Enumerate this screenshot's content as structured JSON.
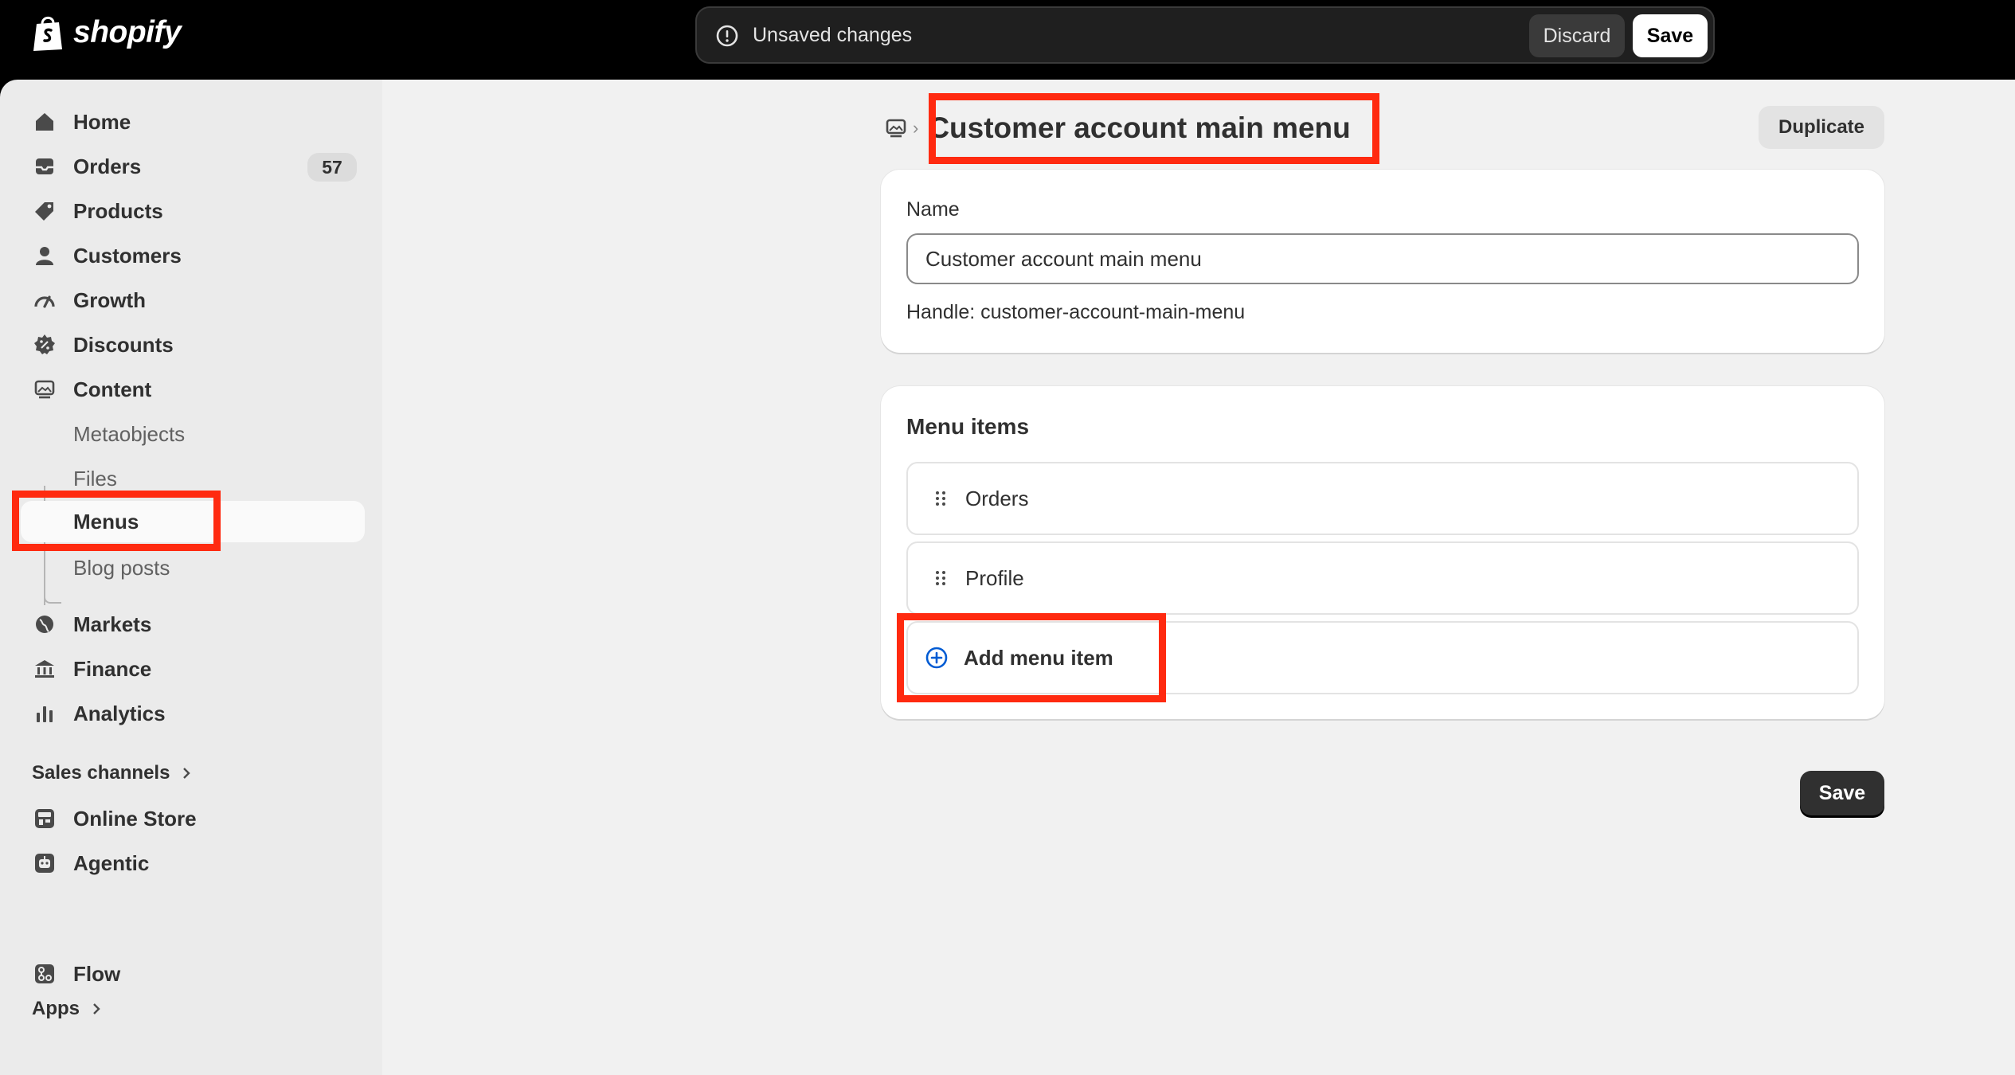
{
  "app": {
    "brand": "shopify"
  },
  "save_bar": {
    "message": "Unsaved changes",
    "discard_label": "Discard",
    "save_label": "Save"
  },
  "sidebar": {
    "items": [
      {
        "label": "Home",
        "icon": "home-icon"
      },
      {
        "label": "Orders",
        "icon": "inbox-icon",
        "badge": "57"
      },
      {
        "label": "Products",
        "icon": "tag-icon"
      },
      {
        "label": "Customers",
        "icon": "person-icon"
      },
      {
        "label": "Growth",
        "icon": "gauge-icon"
      },
      {
        "label": "Discounts",
        "icon": "discount-icon"
      },
      {
        "label": "Content",
        "icon": "image-icon"
      }
    ],
    "content_sub": [
      {
        "label": "Metaobjects"
      },
      {
        "label": "Files"
      },
      {
        "label": "Menus",
        "active": true
      },
      {
        "label": "Blog posts"
      }
    ],
    "items2": [
      {
        "label": "Markets",
        "icon": "globe-icon"
      },
      {
        "label": "Finance",
        "icon": "bank-icon"
      },
      {
        "label": "Analytics",
        "icon": "bar-chart-icon"
      }
    ],
    "sales_channels_heading": "Sales channels",
    "channels": [
      {
        "label": "Online Store",
        "icon": "store-icon"
      },
      {
        "label": "Agentic",
        "icon": "robot-icon"
      }
    ],
    "apps_heading": "Apps",
    "apps": [
      {
        "label": "Flow",
        "icon": "flow-icon"
      }
    ]
  },
  "page": {
    "title": "Customer account main menu",
    "duplicate_label": "Duplicate",
    "name_label": "Name",
    "name_value": "Customer account main menu",
    "handle_text": "Handle: customer-account-main-menu",
    "menu_items_title": "Menu items",
    "menu_items": [
      {
        "label": "Orders"
      },
      {
        "label": "Profile"
      }
    ],
    "add_item_label": "Add menu item",
    "save_label": "Save"
  },
  "colors": {
    "highlight": "#ff2a10",
    "accent_blue": "#005bd3"
  }
}
